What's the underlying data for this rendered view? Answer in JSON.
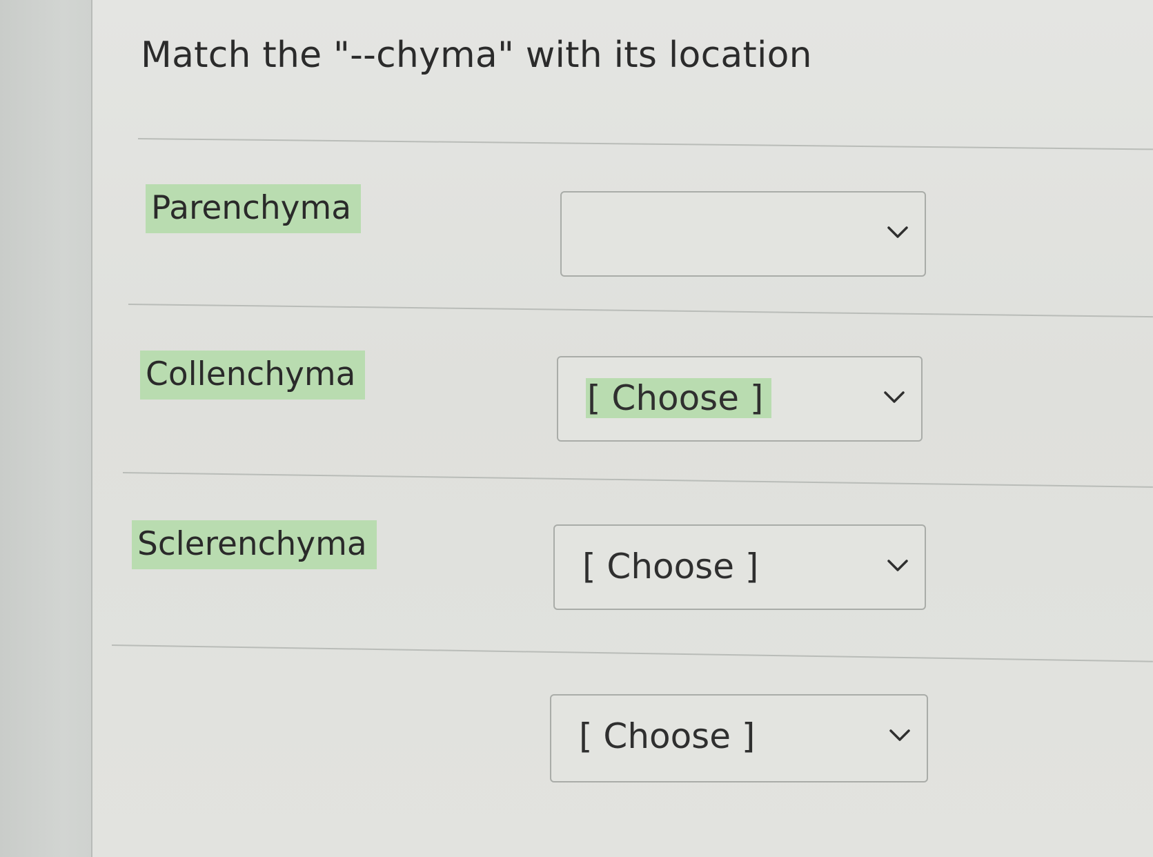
{
  "question": {
    "title": "Match the \"--chyma\" with its location"
  },
  "terms": [
    {
      "label": "Parenchyma"
    },
    {
      "label": "Collenchyma"
    },
    {
      "label": "Sclerenchyma"
    }
  ],
  "answers": [
    {
      "selected": ""
    },
    {
      "selected": "[ Choose ]"
    },
    {
      "selected": "[ Choose ]"
    },
    {
      "selected": "[ Choose ]"
    }
  ],
  "colors": {
    "highlight": "#b9dcb0",
    "select_border": "#a9aca8",
    "divider": "#b9bcb8"
  },
  "icons": {
    "dropdown": "chevron-down-icon"
  }
}
